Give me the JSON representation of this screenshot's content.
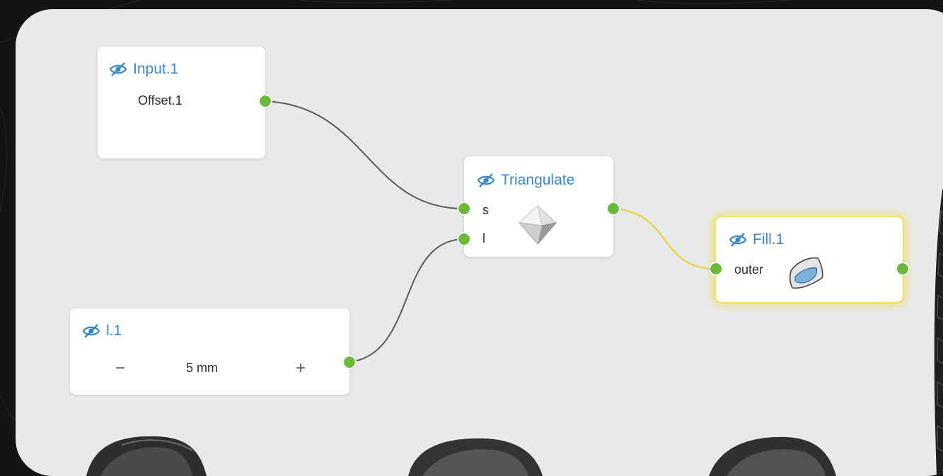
{
  "nodes": {
    "input": {
      "title": "Input.1",
      "value": "Offset.1"
    },
    "triangulate": {
      "title": "Triangulate",
      "port_s": "s",
      "port_l": "l"
    },
    "fill": {
      "title": "Fill.1",
      "port_outer": "outer"
    },
    "length": {
      "title": "l.1",
      "value": "5 mm",
      "minus": "−",
      "plus": "+"
    }
  },
  "colors": {
    "accent": "#3a87c8",
    "port": "#6bb83d",
    "wire": "#5a5a5a",
    "wire_active": "#e8d34a",
    "selection_glow": "#f1e05a"
  },
  "icons": {
    "visibility": "eye-off-icon",
    "triangulate": "octahedron-icon",
    "fill": "surface-fill-icon"
  }
}
